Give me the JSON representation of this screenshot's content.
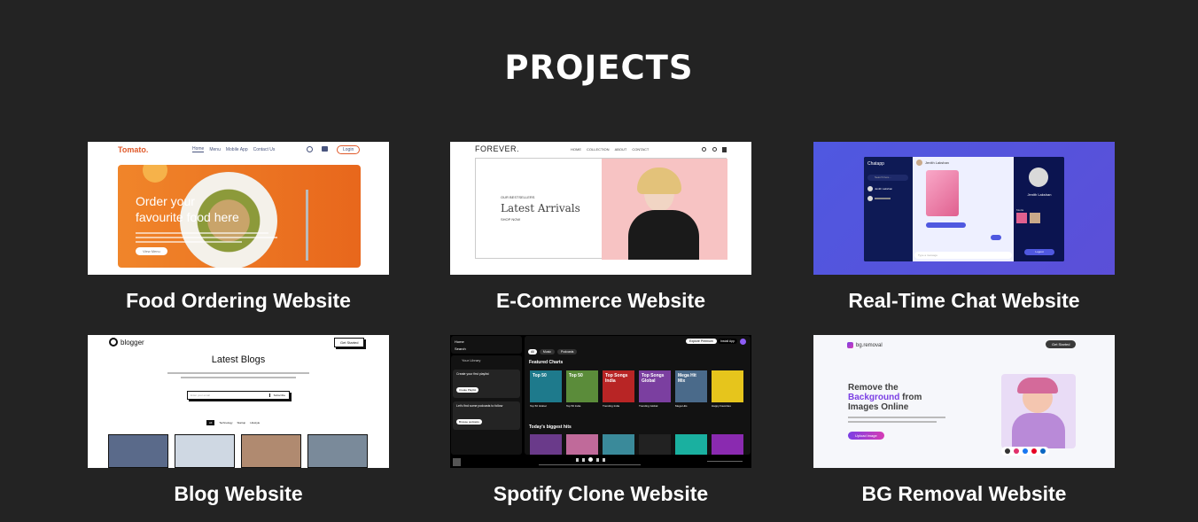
{
  "section": {
    "title": "PROJECTS"
  },
  "projects": [
    {
      "title": "Food Ordering Website"
    },
    {
      "title": "E-Commerce Website"
    },
    {
      "title": "Real-Time Chat Website"
    },
    {
      "title": "Blog Website"
    },
    {
      "title": "Spotify Clone Website"
    },
    {
      "title": "BG Removal Website"
    }
  ],
  "food": {
    "logo": "Tomato.",
    "nav": [
      "Home",
      "Menu",
      "Mobile App",
      "Contact Us"
    ],
    "login": "Login",
    "hero_line1": "Order your",
    "hero_line2": "favourite food here",
    "view_menu": "View Menu"
  },
  "ecom": {
    "logo": "FOREVER.",
    "nav": [
      "HOME",
      "COLLECTION",
      "ABOUT",
      "CONTACT"
    ],
    "kicker": "OUR BESTSELLERS",
    "headline": "Latest Arrivals",
    "shop_now": "SHOP NOW"
  },
  "chat": {
    "app_name": "Chatapp",
    "search": "Search here...",
    "contact_name": "Jenith Lakshan",
    "profile_name": "Jenith Lakshan",
    "media_label": "Media",
    "send_placeholder": "Type a message",
    "logout": "Logout"
  },
  "blog": {
    "logo": "blogger",
    "cta": "Get Started",
    "heading": "Latest Blogs",
    "email_placeholder": "Enter your email",
    "subscribe": "Subscribe",
    "filters": [
      "All",
      "Technology",
      "Startup",
      "Lifestyle"
    ]
  },
  "spotify": {
    "home": "Home",
    "search": "Search",
    "library": "Your Library",
    "explore": "Explore Premium",
    "install": "Install App",
    "chips": [
      "All",
      "Music",
      "Podcasts"
    ],
    "featured": "Featured Charts",
    "biggest": "Today's biggest hits",
    "playlist_prompt": "Create your first playlist",
    "create_playlist": "Create Playlist",
    "podcast_prompt": "Let's find some podcasts to follow",
    "browse_podcasts": "Browse podcasts",
    "cards": [
      {
        "cover": "Top 50",
        "title": "Top 50 Global",
        "color": "#1e7a8c"
      },
      {
        "cover": "Top 50",
        "title": "Top 50 India",
        "color": "#5b8c3a"
      },
      {
        "cover": "Top Songs India",
        "title": "Trending India",
        "color": "#b82525"
      },
      {
        "cover": "Top Songs Global",
        "title": "Trending Global",
        "color": "#7b3fa0"
      },
      {
        "cover": "Mega Hit Mix",
        "title": "Mega Hits",
        "color": "#4a6a8a"
      },
      {
        "cover": "",
        "title": "Happy Favorites",
        "color": "#e6c51c"
      }
    ]
  },
  "bg": {
    "logo": "bg.removal",
    "cta": "Get Started",
    "line1": "Remove the",
    "line2_accent": "Background",
    "line2_rest": " from",
    "line3": "Images Online",
    "upload": "Upload image"
  }
}
